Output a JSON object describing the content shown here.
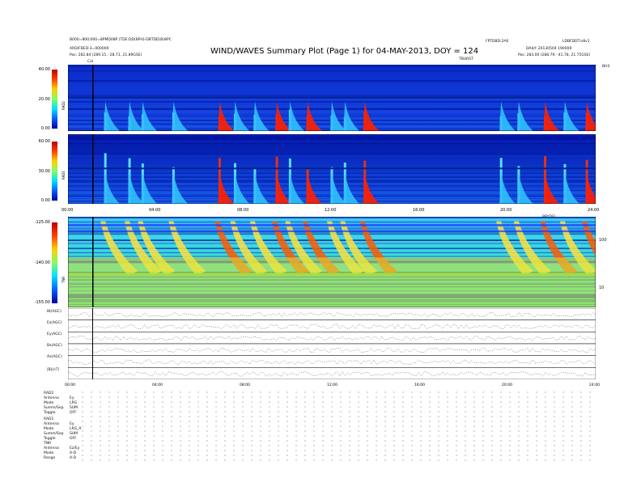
{
  "header": {
    "title": "WIND/WAVES Summary Plot (Page 1) for 04-MAY-2013, DOY = 124",
    "left_line1": "B000=800;000=8PMD08P (TDE:DD(BPH)-DBTDD(B)8PC",
    "left_line2": "ARD/FBED:3=000000",
    "left_line3": "Pos:  282.84 (289.15, -28.71, 21.89GSE)",
    "right_top_a": "FPTDBD:2A0",
    "right_top_b": "LDBFDDT:n8v1",
    "right_line2": "DAILY: 20130504 190000",
    "right_line3": "Pos:  283.00 (288.79, -41.78, 21.75GSE)",
    "cal_label": "Cal",
    "marker_label": "TBURST",
    "marker_label_2": "BBYDEL",
    "corner_label": "BH3"
  },
  "colors": {
    "spectrogram_low": "#0000c8",
    "spectrogram_mid": "#00c8ff",
    "spectrogram_high": "#ff2800"
  },
  "rad2": {
    "label": "RAD2",
    "ticks": [
      "40.00",
      "20.00",
      "0.00"
    ]
  },
  "rad1": {
    "label": "RAD1",
    "ticks": [
      "60.00",
      "30.00",
      "0.00"
    ]
  },
  "tnr": {
    "label": "TNR",
    "ticks": [
      "-125.00",
      "-140.00",
      "-155.00"
    ],
    "right_ticks": [
      "100",
      "10"
    ]
  },
  "time_axis": {
    "labels": [
      "00:00",
      "04:00",
      "08:00",
      "12:00",
      "16:00",
      "20:00",
      "24:00"
    ]
  },
  "line_panels": [
    {
      "label": "Bt(AGC)"
    },
    {
      "label": "Ez(AGC)"
    },
    {
      "label": "Ey(AGC)"
    },
    {
      "label": "Bx(AGC)"
    },
    {
      "label": "Ax(AGC)"
    },
    {
      "label": "|B|(nT)"
    }
  ],
  "footer": {
    "rad2_block": [
      "RAD2",
      "Antenna",
      "Mode",
      "Summ/Sep",
      "Toggle"
    ],
    "rad2_values": [
      "Ey",
      "LRG",
      "SUM",
      "OFF"
    ],
    "rad1_block": [
      "RAD1",
      "Antenna",
      "Mode",
      "Summ/Sep",
      "Toggle"
    ],
    "rad1_values": [
      "Ey",
      "LRG_A",
      "SUM",
      "OFF"
    ],
    "tnr_block": [
      "TNR",
      "Antenna",
      "Mode",
      "Range"
    ],
    "tnr_values": [
      "Ez/Ey",
      "A-D",
      "A-D"
    ]
  },
  "chart_data": {
    "type": "heatmap",
    "title": "WIND/WAVES Summary Plot (Page 1) for 04-MAY-2013, DOY = 124",
    "x": {
      "label": "",
      "range": [
        "00:00",
        "24:00"
      ],
      "ticks": [
        "00:00",
        "04:00",
        "08:00",
        "12:00",
        "16:00",
        "20:00",
        "24:00"
      ]
    },
    "panels": [
      {
        "name": "RAD2",
        "ylim": [
          0,
          40
        ],
        "ticks": [
          0,
          20,
          40
        ]
      },
      {
        "name": "RAD1",
        "ylim": [
          0,
          60
        ],
        "ticks": [
          0,
          30,
          60
        ]
      },
      {
        "name": "TNR",
        "ylim": [
          -155,
          -125
        ],
        "ticks": [
          -155,
          -140,
          -125
        ]
      }
    ],
    "bursts_hours": [
      1.7,
      2.8,
      3.4,
      4.8,
      6.9,
      7.6,
      8.5,
      9.5,
      10.1,
      10.9,
      12.0,
      12.6,
      13.5,
      19.7,
      20.5,
      21.7,
      22.6,
      23.6
    ],
    "strong_bursts_hours": [
      6.9,
      9.5,
      10.9,
      13.5,
      21.7,
      23.6
    ]
  }
}
